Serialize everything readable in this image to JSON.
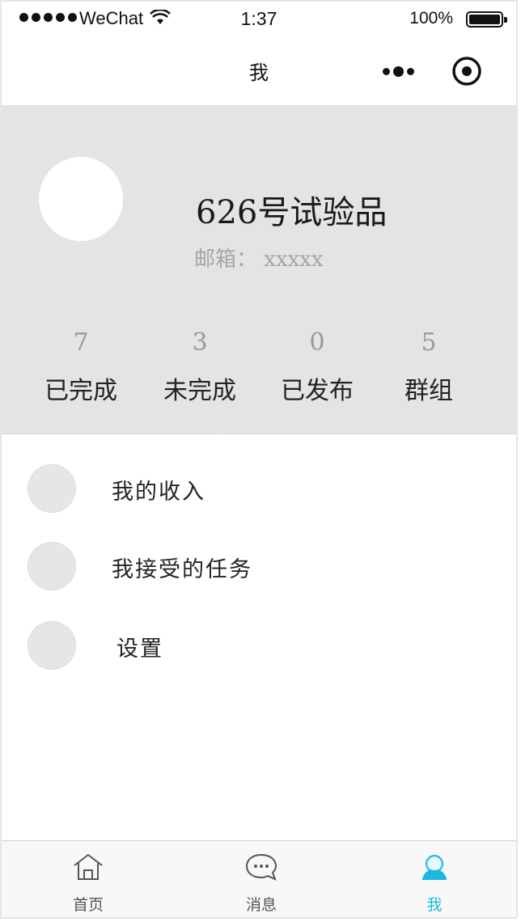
{
  "status_bar": {
    "carrier": "WeChat",
    "time": "1:37",
    "battery": "100%"
  },
  "nav": {
    "title": "我"
  },
  "profile": {
    "name": "626号试验品",
    "email_label": "邮箱：",
    "email_value": "xxxxx",
    "stats": [
      {
        "value": "7",
        "label": "已完成"
      },
      {
        "value": "3",
        "label": "未完成"
      },
      {
        "value": "0",
        "label": "已发布"
      },
      {
        "value": "5",
        "label": "群组"
      }
    ]
  },
  "menu": [
    {
      "label": "我的收入"
    },
    {
      "label": "我接受的任务"
    },
    {
      "label": "设置"
    }
  ],
  "tabbar": {
    "active_color": "#1cb8e0",
    "tabs": [
      {
        "label": "首页",
        "icon": "home-icon"
      },
      {
        "label": "消息",
        "icon": "message-icon"
      },
      {
        "label": "我",
        "icon": "profile-icon"
      }
    ]
  }
}
